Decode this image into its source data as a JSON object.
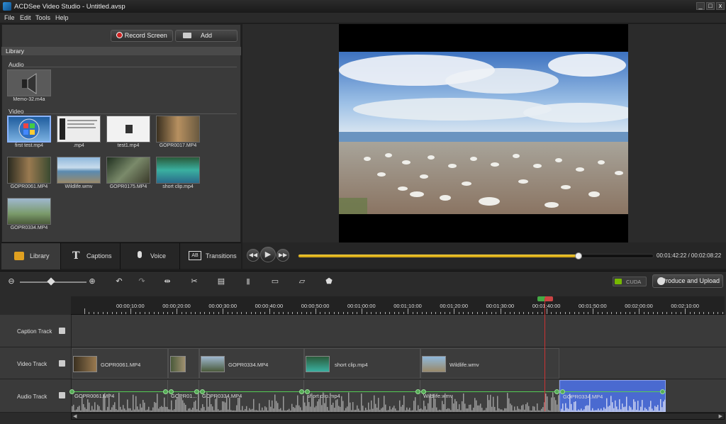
{
  "window": {
    "title": "ACDSee Video Studio - Untitled.avsp",
    "min": "_",
    "max": "□",
    "close": "x"
  },
  "menu": [
    "File",
    "Edit",
    "Tools",
    "Help"
  ],
  "library": {
    "record_label": "Record Screen",
    "add_label": "Add",
    "header": "Library",
    "audio_section": "Audio",
    "video_section": "Video",
    "audio_items": [
      {
        "name": "Memo-32.m4a"
      }
    ],
    "video_items": [
      {
        "name": "first test.mp4"
      },
      {
        "name": ".mp4"
      },
      {
        "name": "test1.mp4"
      },
      {
        "name": "GOPR0017.MP4"
      },
      {
        "name": "GOPR0061.MP4"
      },
      {
        "name": "Wildlife.wmv"
      },
      {
        "name": "GOPR0175.MP4"
      },
      {
        "name": "short clip.mp4"
      },
      {
        "name": "GOPR0334.MP4"
      }
    ]
  },
  "tabs": [
    {
      "label": "Library"
    },
    {
      "label": "Captions"
    },
    {
      "label": "Voice"
    },
    {
      "label": "Transitions"
    }
  ],
  "player": {
    "timecode": "00:01:42:22 / 00:02:08:22",
    "progress": 0.79
  },
  "toolbar": {
    "cuda_label": "CUDA",
    "produce_label": "Produce and Upload"
  },
  "timeline": {
    "ticks": [
      "00:00:10:00",
      "00:00:20:00",
      "00:00:30:00",
      "00:00:40:00",
      "00:00:50:00",
      "00:01:00:00",
      "00:01:10:00",
      "00:01:20:00",
      "00:01:30:00",
      "00:01:40:00",
      "00:01:50:00",
      "00:02:00:00",
      "00:02:10:00"
    ],
    "tracks": {
      "caption": "Caption Track",
      "video": "Video Track",
      "audio": "Audio Track"
    },
    "video_clips": [
      "GOPR0061.MP4",
      "",
      "GOPR0334.MP4",
      "short clip.mp4",
      "Wildlife.wmv"
    ],
    "audio_clips": [
      "GOPR0061.MP4",
      "GOPR01...",
      "GOPR0334.MP4",
      "short clip.mp4",
      "Wildlife.wmv",
      "GOPR0334.MP4"
    ]
  },
  "colors": {
    "accent": "#f0c020",
    "selected_audio": "#4a6ad0",
    "playhead": "#cc3333"
  }
}
